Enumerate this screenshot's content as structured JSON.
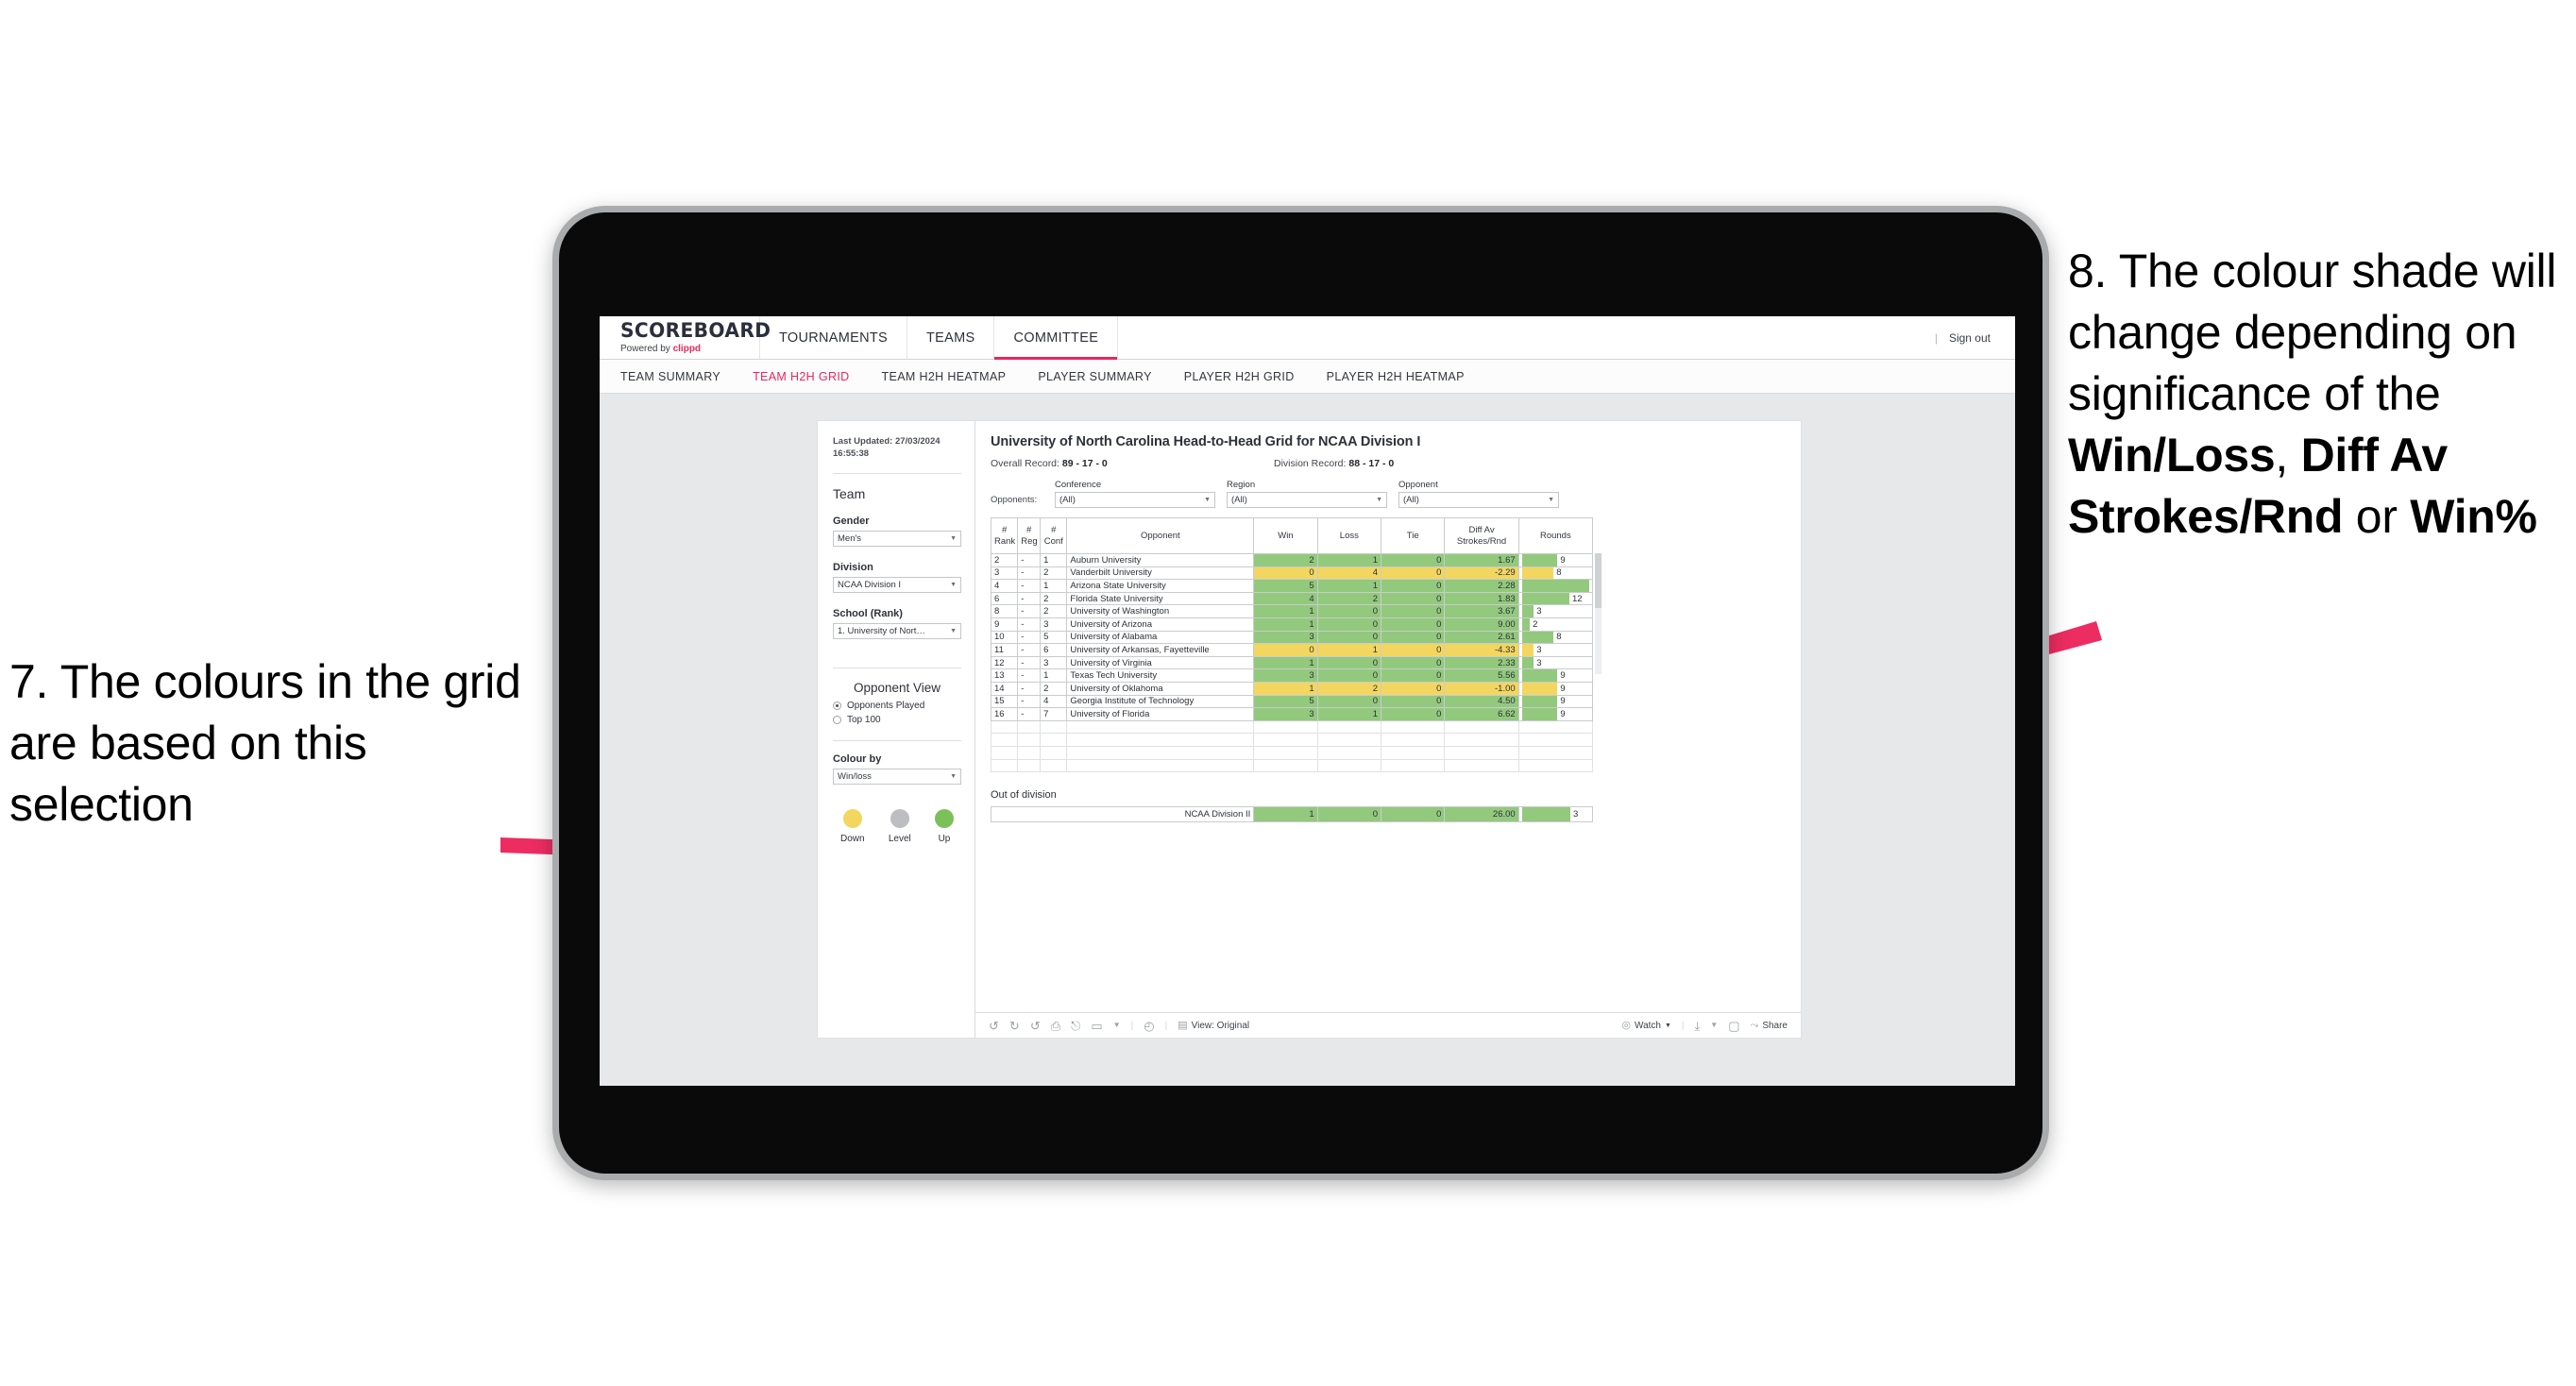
{
  "annotations": {
    "left": {
      "number": "7.",
      "text": "7. The colours in the grid are based on this selection"
    },
    "right": {
      "number": "8.",
      "line1": "8. The colour shade will change depending on significance of the ",
      "bold1": "Win/Loss",
      "mid1": ", ",
      "bold2": "Diff Av Strokes/Rnd",
      "mid2": " or ",
      "bold3": "Win%"
    },
    "arrow_color": "#ed2c62"
  },
  "app": {
    "brand": {
      "title": "SCOREBOARD",
      "powered_prefix": "Powered by ",
      "powered_brand": "clippd"
    },
    "topnav": [
      {
        "label": "TOURNAMENTS",
        "active": false
      },
      {
        "label": "TEAMS",
        "active": false
      },
      {
        "label": "COMMITTEE",
        "active": true
      }
    ],
    "topbar_right": {
      "divider": "|",
      "sign_out": "Sign out"
    },
    "subnav": [
      {
        "label": "TEAM SUMMARY",
        "active": false
      },
      {
        "label": "TEAM H2H GRID",
        "active": true
      },
      {
        "label": "TEAM H2H HEATMAP",
        "active": false
      },
      {
        "label": "PLAYER SUMMARY",
        "active": false
      },
      {
        "label": "PLAYER H2H GRID",
        "active": false
      },
      {
        "label": "PLAYER H2H HEATMAP",
        "active": false
      }
    ]
  },
  "sidebar": {
    "last_updated": "Last Updated: 27/03/2024 16:55:38",
    "team_heading": "Team",
    "gender_label": "Gender",
    "gender_value": "Men's",
    "division_label": "Division",
    "division_value": "NCAA Division I",
    "school_label": "School (Rank)",
    "school_value": "1. University of Nort…",
    "opponent_view_heading": "Opponent View",
    "opponent_view_options": [
      {
        "label": "Opponents Played",
        "selected": true
      },
      {
        "label": "Top 100",
        "selected": false
      }
    ],
    "colour_by_label": "Colour by",
    "colour_by_value": "Win/loss",
    "legend": [
      {
        "label": "Down",
        "color": "#f3d660"
      },
      {
        "label": "Level",
        "color": "#bcbec1"
      },
      {
        "label": "Up",
        "color": "#7cc05a"
      }
    ]
  },
  "main": {
    "title": "University of North Carolina Head-to-Head Grid for NCAA Division I",
    "overall_record_label": "Overall Record: ",
    "overall_record_value": "89 - 17 - 0",
    "division_record_label": "Division Record: ",
    "division_record_value": "88 - 17 - 0",
    "opponents_label": "Opponents:",
    "filters": [
      {
        "caption": "Conference",
        "value": "(All)"
      },
      {
        "caption": "Region",
        "value": "(All)"
      },
      {
        "caption": "Opponent",
        "value": "(All)"
      }
    ]
  },
  "chart_data": {
    "type": "table",
    "title": "University of North Carolina Head-to-Head Grid for NCAA Division I",
    "columns": [
      "# Rank",
      "# Reg",
      "# Conf",
      "Opponent",
      "Win",
      "Loss",
      "Tie",
      "Diff Av Strokes/Rnd",
      "Rounds"
    ],
    "column_headers_multiline": [
      [
        "#",
        "Rank"
      ],
      [
        "#",
        "Reg"
      ],
      [
        "#",
        "Conf"
      ],
      [
        "",
        "Opponent"
      ],
      [
        "",
        "Win"
      ],
      [
        "",
        "Loss"
      ],
      [
        "",
        "Tie"
      ],
      [
        "Diff Av",
        "Strokes/Rnd"
      ],
      [
        "",
        "Rounds"
      ]
    ],
    "rounds_max": 17,
    "rows": [
      {
        "rank": "2",
        "reg": "-",
        "conf": "1",
        "opponent": "Auburn University",
        "win": "2",
        "loss": "1",
        "tie": "0",
        "diff": "1.67",
        "rounds": "9",
        "shade": "g"
      },
      {
        "rank": "3",
        "reg": "-",
        "conf": "2",
        "opponent": "Vanderbilt University",
        "win": "0",
        "loss": "4",
        "tie": "0",
        "diff": "-2.29",
        "rounds": "8",
        "shade": "y"
      },
      {
        "rank": "4",
        "reg": "-",
        "conf": "1",
        "opponent": "Arizona State University",
        "win": "5",
        "loss": "1",
        "tie": "0",
        "diff": "2.28",
        "rounds": "17",
        "shade": "g"
      },
      {
        "rank": "6",
        "reg": "-",
        "conf": "2",
        "opponent": "Florida State University",
        "win": "4",
        "loss": "2",
        "tie": "0",
        "diff": "1.83",
        "rounds": "12",
        "shade": "g"
      },
      {
        "rank": "8",
        "reg": "-",
        "conf": "2",
        "opponent": "University of Washington",
        "win": "1",
        "loss": "0",
        "tie": "0",
        "diff": "3.67",
        "rounds": "3",
        "shade": "g"
      },
      {
        "rank": "9",
        "reg": "-",
        "conf": "3",
        "opponent": "University of Arizona",
        "win": "1",
        "loss": "0",
        "tie": "0",
        "diff": "9.00",
        "rounds": "2",
        "shade": "g"
      },
      {
        "rank": "10",
        "reg": "-",
        "conf": "5",
        "opponent": "University of Alabama",
        "win": "3",
        "loss": "0",
        "tie": "0",
        "diff": "2.61",
        "rounds": "8",
        "shade": "g"
      },
      {
        "rank": "11",
        "reg": "-",
        "conf": "6",
        "opponent": "University of Arkansas, Fayetteville",
        "win": "0",
        "loss": "1",
        "tie": "0",
        "diff": "-4.33",
        "rounds": "3",
        "shade": "y"
      },
      {
        "rank": "12",
        "reg": "-",
        "conf": "3",
        "opponent": "University of Virginia",
        "win": "1",
        "loss": "0",
        "tie": "0",
        "diff": "2.33",
        "rounds": "3",
        "shade": "g"
      },
      {
        "rank": "13",
        "reg": "-",
        "conf": "1",
        "opponent": "Texas Tech University",
        "win": "3",
        "loss": "0",
        "tie": "0",
        "diff": "5.56",
        "rounds": "9",
        "shade": "g"
      },
      {
        "rank": "14",
        "reg": "-",
        "conf": "2",
        "opponent": "University of Oklahoma",
        "win": "1",
        "loss": "2",
        "tie": "0",
        "diff": "-1.00",
        "rounds": "9",
        "shade": "y"
      },
      {
        "rank": "15",
        "reg": "-",
        "conf": "4",
        "opponent": "Georgia Institute of Technology",
        "win": "5",
        "loss": "0",
        "tie": "0",
        "diff": "4.50",
        "rounds": "9",
        "shade": "g"
      },
      {
        "rank": "16",
        "reg": "-",
        "conf": "7",
        "opponent": "University of Florida",
        "win": "3",
        "loss": "1",
        "tie": "0",
        "diff": "6.62",
        "rounds": "9",
        "shade": "g"
      }
    ],
    "out_of_division": {
      "heading": "Out of division",
      "rows": [
        {
          "label": "NCAA Division II",
          "win": "1",
          "loss": "0",
          "tie": "0",
          "diff": "26.00",
          "rounds": "3",
          "shade": "g"
        }
      ]
    },
    "colors": {
      "up": "#93c97d",
      "down": "#f3d660",
      "level": "#bcbec1",
      "accent": "#e8275a"
    }
  },
  "toolbar": {
    "left_icons": [
      "undo-icon",
      "redo-icon",
      "revert-icon",
      "refresh-icon",
      "pause-icon",
      "shape-icon",
      "caret-icon"
    ],
    "clock_icon": "clock-icon",
    "view_icon": "view-icon",
    "view_label": "View: Original",
    "watch_icon": "watch-icon",
    "watch_label": "Watch",
    "download_icon": "download-icon",
    "device_icon": "device-icon",
    "share_icon": "share-icon",
    "share_label": "Share"
  }
}
